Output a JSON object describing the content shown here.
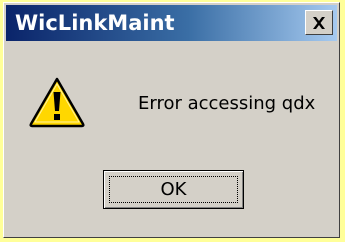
{
  "window": {
    "title": "WicLinkMaint",
    "close_icon": "close-icon"
  },
  "dialog": {
    "icon": "warning-icon",
    "message": "Error accessing qdx",
    "ok_label": "OK"
  },
  "colors": {
    "background": "#ffff99",
    "titlebar_start": "#0a246a",
    "titlebar_end": "#a6caf0",
    "dialog_face": "#d4d0c8",
    "warning_fill": "#ffd700"
  }
}
